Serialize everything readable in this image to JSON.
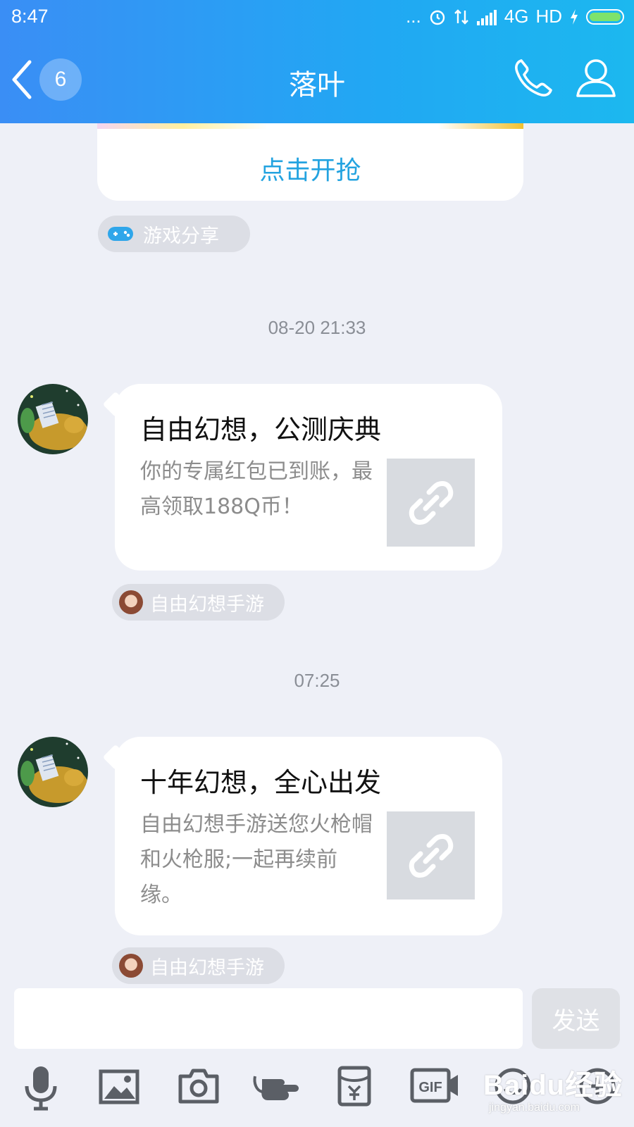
{
  "status_bar": {
    "time": "8:47",
    "dots": "...",
    "network": "4G",
    "hd": "HD"
  },
  "header": {
    "badge_count": "6",
    "contact_name": "落叶"
  },
  "messages": {
    "partial_card": {
      "action": "点击开抢",
      "source_label": "游戏分享"
    },
    "timestamp1": "08-20 21:33",
    "msg1": {
      "title": "自由幻想，公测庆典",
      "desc": "你的专属红包已到账，最高领取188Q币！",
      "source": "自由幻想手游"
    },
    "timestamp2": "07:25",
    "msg2": {
      "title": "十年幻想，全心出发",
      "desc": "自由幻想手游送您火枪帽和火枪服;一起再续前缘。",
      "source": "自由幻想手游"
    }
  },
  "input": {
    "value": "",
    "send_label": "发送"
  },
  "toolbar": {
    "gif_label": "GIF"
  },
  "watermark": {
    "main": "Baidu经验",
    "sub": "jingyan.baidu.com"
  },
  "icons": [
    "back-arrow-icon",
    "phone-icon",
    "profile-icon",
    "gamepad-icon",
    "link-icon",
    "microphone-icon",
    "image-icon",
    "camera-icon",
    "poke-icon",
    "red-envelope-icon",
    "gif-icon",
    "emoji-icon",
    "plus-icon"
  ],
  "colors": {
    "header_start": "#3a8ef5",
    "header_end": "#1cb8ef",
    "link_blue": "#23a3e0",
    "background": "#eef0f7"
  }
}
